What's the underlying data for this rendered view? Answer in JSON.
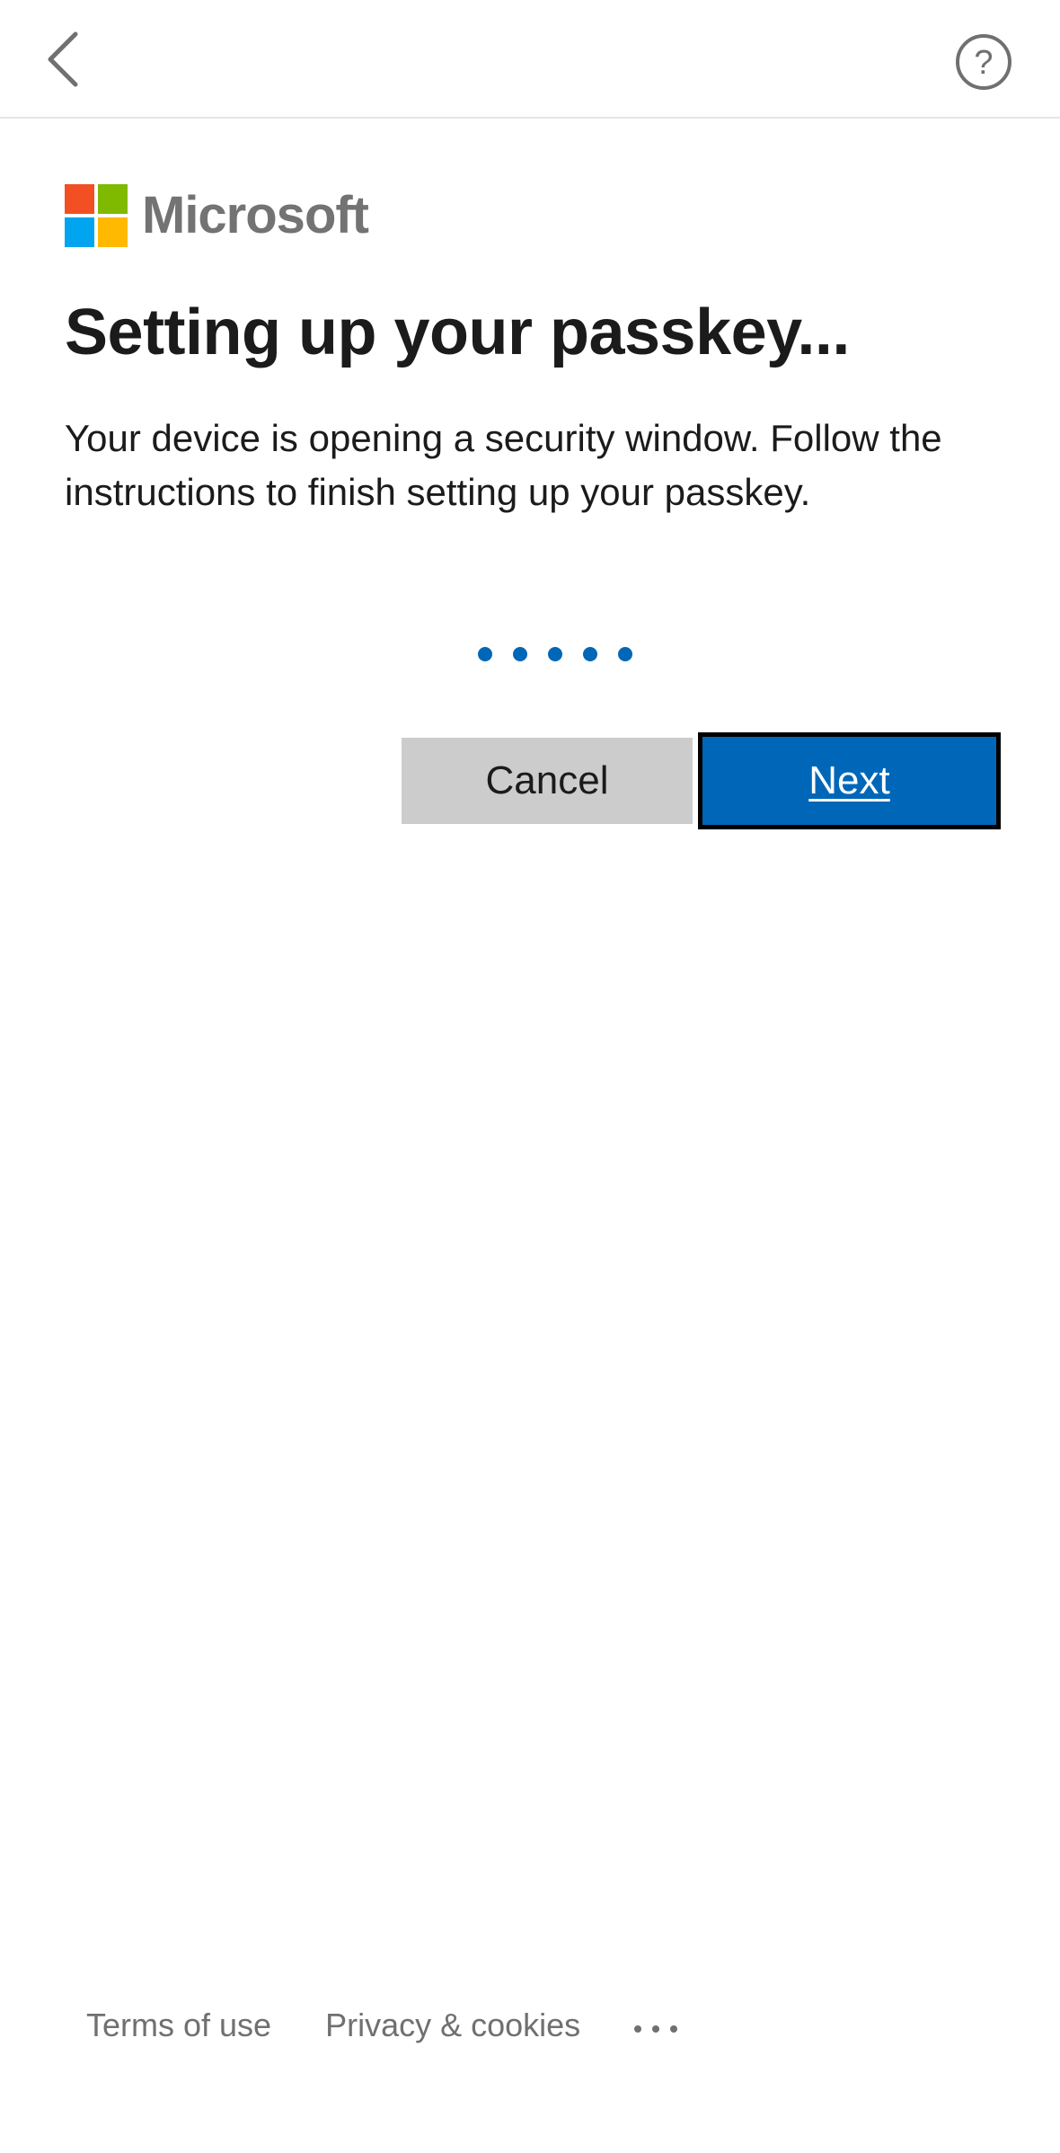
{
  "header": {
    "back_icon": "chevron-left-icon",
    "help_icon": "question-circle-icon",
    "help_glyph": "?"
  },
  "brand": {
    "name": "Microsoft",
    "logo_colors": [
      "#f25022",
      "#7fba00",
      "#00a4ef",
      "#ffb900"
    ],
    "text_color": "#737373"
  },
  "main": {
    "title": "Setting up your passkey...",
    "description": "Your device is opening a security window. Follow the instructions to finish setting up your passkey.",
    "progress_dot_count": 5,
    "accent_color": "#0067b8"
  },
  "actions": {
    "cancel_label": "Cancel",
    "next_label": "Next"
  },
  "footer": {
    "terms_label": "Terms of use",
    "privacy_label": "Privacy & cookies",
    "more_icon": "more-options-icon"
  }
}
